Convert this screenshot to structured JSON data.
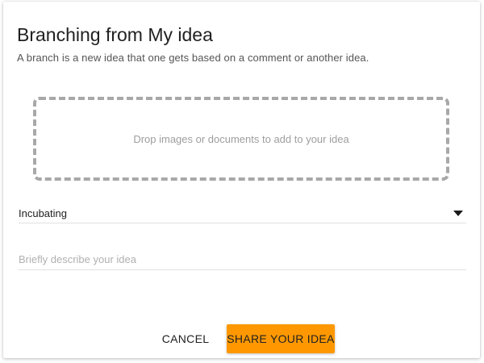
{
  "dialog": {
    "title": "Branching from My idea",
    "subtitle": "A branch is a new idea that one gets based on a comment or another idea."
  },
  "dropzone": {
    "text": "Drop images or documents to add to your idea"
  },
  "status_select": {
    "value": "Incubating",
    "icon": "dropdown-arrow-icon"
  },
  "description_input": {
    "value": "",
    "placeholder": "Briefly describe your idea"
  },
  "actions": {
    "cancel_label": "CANCEL",
    "share_label": "SHARE YOUR IDEA"
  },
  "colors": {
    "accent": "#ff9800",
    "dropzone_border": "#a8a8a8"
  }
}
